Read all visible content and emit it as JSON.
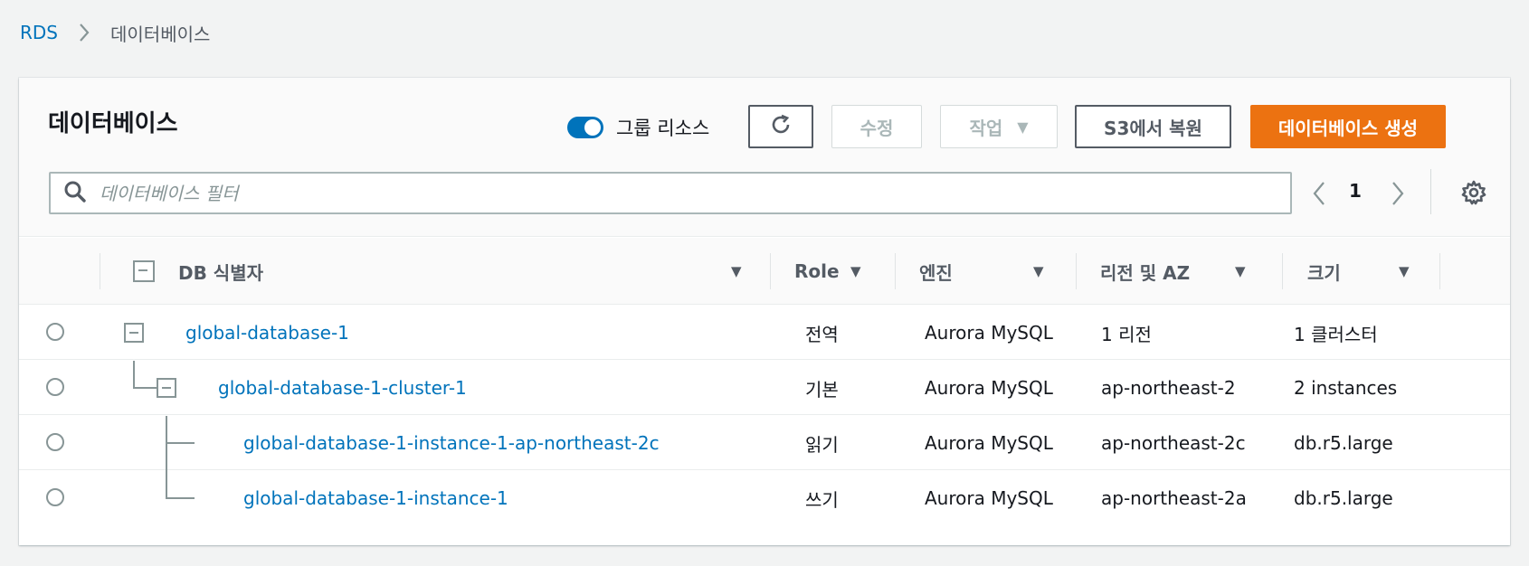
{
  "breadcrumb": {
    "root": "RDS",
    "current": "데이터베이스"
  },
  "panel": {
    "title": "데이터베이스",
    "group_toggle_label": "그룹 리소스",
    "group_toggle_on": true,
    "buttons": {
      "modify": "수정",
      "actions": "작업",
      "restore_s3": "S3에서 복원",
      "create": "데이터베이스 생성"
    },
    "search_placeholder": "데이터베이스 필터",
    "page": "1"
  },
  "table": {
    "headers": {
      "identifier": "DB 식별자",
      "role": "Role",
      "engine": "엔진",
      "region": "리전 및 AZ",
      "size": "크기"
    },
    "rows": [
      {
        "identifier": "global-database-1",
        "role": "전역",
        "engine": "Aurora MySQL",
        "region": "1 리전",
        "size": "1 클러스터"
      },
      {
        "identifier": "global-database-1-cluster-1",
        "role": "기본",
        "engine": "Aurora MySQL",
        "region": "ap-northeast-2",
        "size": "2 instances"
      },
      {
        "identifier": "global-database-1-instance-1-ap-northeast-2c",
        "role": "읽기",
        "engine": "Aurora MySQL",
        "region": "ap-northeast-2c",
        "size": "db.r5.large"
      },
      {
        "identifier": "global-database-1-instance-1",
        "role": "쓰기",
        "engine": "Aurora MySQL",
        "region": "ap-northeast-2a",
        "size": "db.r5.large"
      }
    ]
  },
  "colors": {
    "accent": "#0073bb",
    "primary": "#ec7211"
  }
}
